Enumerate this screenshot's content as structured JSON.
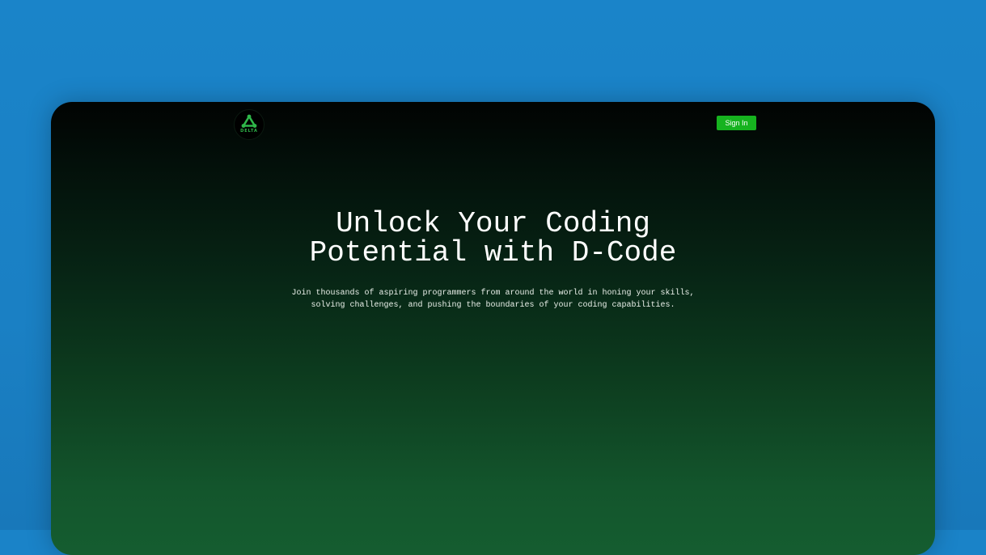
{
  "brand": {
    "logo_text": "DELTA",
    "logo_icon": "delta-triangle-icon",
    "accent": "#16b31f"
  },
  "header": {
    "signin_label": "Sign In"
  },
  "hero": {
    "title_line1": "Unlock Your Coding",
    "title_line2": "Potential with D-Code",
    "subtitle": "Join thousands of aspiring programmers from around the world in honing your skills, solving challenges, and pushing the boundaries of your coding capabilities."
  },
  "colors": {
    "background": "#1a83c8",
    "window_top": "#010302",
    "window_bottom": "#155d30",
    "button": "#16b31f"
  }
}
